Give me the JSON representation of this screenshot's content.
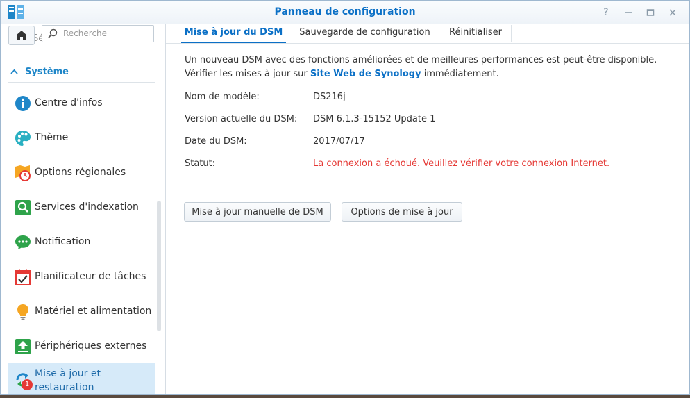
{
  "window": {
    "title": "Panneau de configuration"
  },
  "search": {
    "placeholder": "Recherche"
  },
  "sidebar": {
    "partial_item": "Sécurité",
    "section_header": "Système",
    "items": [
      {
        "label": "Centre d'infos",
        "icon": "info-icon"
      },
      {
        "label": "Thème",
        "icon": "palette-icon"
      },
      {
        "label": "Options régionales",
        "icon": "regional-clock-icon"
      },
      {
        "label": "Services d'indexation",
        "icon": "index-search-icon"
      },
      {
        "label": "Notification",
        "icon": "chat-bubble-icon"
      },
      {
        "label": "Planificateur de tâches",
        "icon": "calendar-check-icon"
      },
      {
        "label": "Matériel et alimentation",
        "icon": "lightbulb-icon"
      },
      {
        "label": "Périphériques externes",
        "icon": "upload-device-icon"
      },
      {
        "label": "Mise à jour et restauration",
        "icon": "update-arrows-icon",
        "badge": "1"
      }
    ]
  },
  "tabs": [
    {
      "label": "Mise à jour du DSM",
      "active": true
    },
    {
      "label": "Sauvegarde de configuration",
      "active": false
    },
    {
      "label": "Réinitialiser",
      "active": false
    }
  ],
  "main": {
    "intro_before": "Un nouveau DSM avec des fonctions améliorées et de meilleures performances est peut-être disponible. Vérifier les mises à jour sur ",
    "intro_link": "Site Web de Synology",
    "intro_after": " immédiatement.",
    "fields": [
      {
        "label": "Nom de modèle:",
        "value": "DS216j"
      },
      {
        "label": "Version actuelle du DSM:",
        "value": "DSM 6.1.3-15152 Update 1"
      },
      {
        "label": "Date du DSM:",
        "value": "2017/07/17"
      },
      {
        "label": "Statut:",
        "value": "La connexion a échoué. Veuillez vérifier votre connexion Internet."
      }
    ],
    "buttons": {
      "manual_update": "Mise à jour manuelle de DSM",
      "update_options": "Options de mise à jour"
    }
  },
  "colors": {
    "accent": "#0b70c6",
    "error": "#e53935",
    "active_bg": "#d6eaf9"
  }
}
